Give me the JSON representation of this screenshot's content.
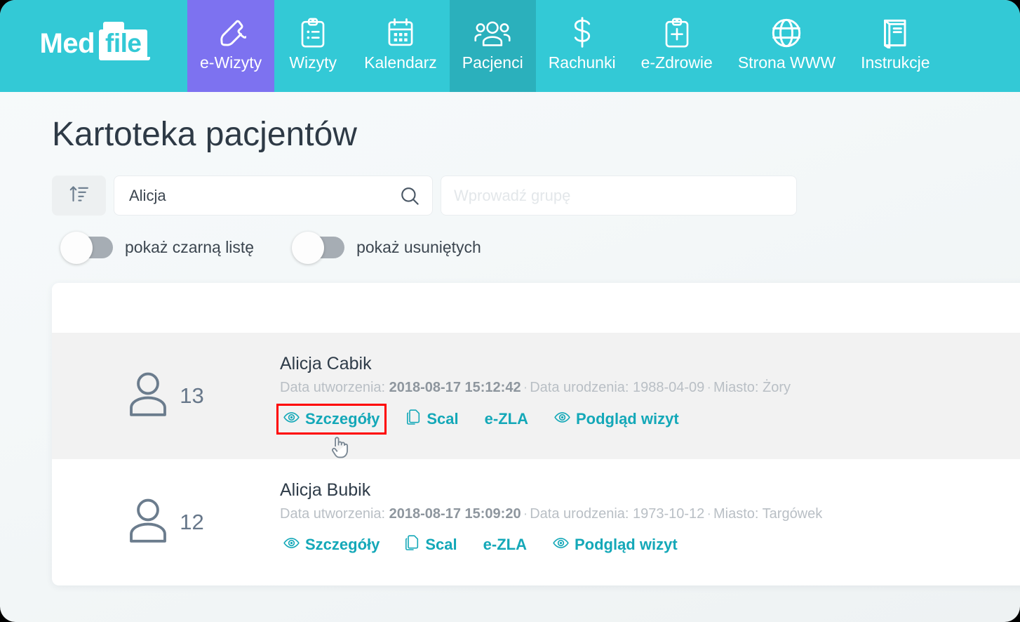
{
  "brand": {
    "part1": "Med",
    "part2": "file"
  },
  "nav": {
    "items": [
      {
        "label": "e-Wizyty",
        "icon": "phone-icon",
        "state": "purple"
      },
      {
        "label": "Wizyty",
        "icon": "clipboard-list-icon",
        "state": "normal"
      },
      {
        "label": "Kalendarz",
        "icon": "calendar-icon",
        "state": "normal"
      },
      {
        "label": "Pacjenci",
        "icon": "people-icon",
        "state": "active"
      },
      {
        "label": "Rachunki",
        "icon": "dollar-icon",
        "state": "normal"
      },
      {
        "label": "e-Zdrowie",
        "icon": "clipboard-plus-icon",
        "state": "normal"
      },
      {
        "label": "Strona WWW",
        "icon": "globe-icon",
        "state": "normal"
      },
      {
        "label": "Instrukcje",
        "icon": "book-icon",
        "state": "normal"
      }
    ]
  },
  "page": {
    "title": "Kartoteka pacjentów"
  },
  "filters": {
    "sort_icon": "sort-ascending-icon",
    "search": {
      "value": "Alicja",
      "placeholder": "",
      "icon": "search-icon"
    },
    "group": {
      "value": "",
      "placeholder": "Wprowadź grupę"
    }
  },
  "toggles": [
    {
      "label": "pokaż czarną listę",
      "on": false
    },
    {
      "label": "pokaż usuniętych",
      "on": false
    }
  ],
  "labels": {
    "created": "Data utworzenia:",
    "birth": "Data urodzenia:",
    "city": "Miasto:",
    "sep": "·"
  },
  "patients": [
    {
      "id": "13",
      "name": "Alicja Cabik",
      "created": "2018-08-17 15:12:42",
      "birth": "1988-04-09",
      "city": "Żory",
      "highlighted_row": true,
      "actions": [
        {
          "label": "Szczegóły",
          "icon": "eye-icon",
          "highlighted": true
        },
        {
          "label": "Scal",
          "icon": "copy-icon",
          "highlighted": false
        },
        {
          "label": "e-ZLA",
          "icon": "",
          "highlighted": false
        },
        {
          "label": "Podgląd wizyt",
          "icon": "eye-icon",
          "highlighted": false
        }
      ]
    },
    {
      "id": "12",
      "name": "Alicja Bubik",
      "created": "2018-08-17 15:09:20",
      "birth": "1973-10-12",
      "city": "Targówek",
      "highlighted_row": false,
      "actions": [
        {
          "label": "Szczegóły",
          "icon": "eye-icon",
          "highlighted": false
        },
        {
          "label": "Scal",
          "icon": "copy-icon",
          "highlighted": false
        },
        {
          "label": "e-ZLA",
          "icon": "",
          "highlighted": false
        },
        {
          "label": "Podgląd wizyt",
          "icon": "eye-icon",
          "highlighted": false
        }
      ]
    }
  ],
  "colors": {
    "brand_teal": "#33c9d6",
    "active_teal": "#2bb0bc",
    "purple": "#7d72f0",
    "link_teal": "#14a8b8",
    "highlight_red": "#ff0000"
  }
}
